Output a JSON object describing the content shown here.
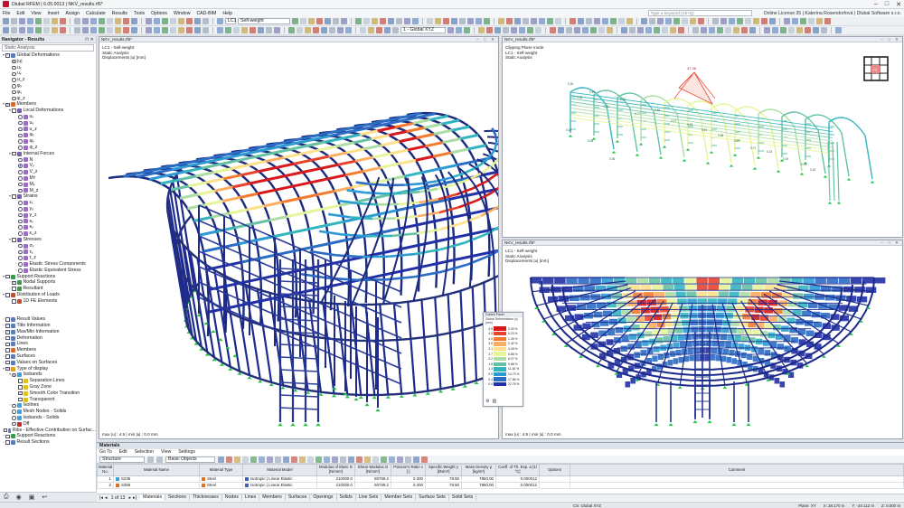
{
  "app": {
    "title": "Dlubal RFEM | 6.05.0013 | NKV_results.rf6*"
  },
  "menu": [
    "File",
    "Edit",
    "View",
    "Insert",
    "Assign",
    "Calculate",
    "Results",
    "Tools",
    "Options",
    "Window",
    "CAD-BIM",
    "Help"
  ],
  "search": {
    "placeholder": "Type a keyword (Alt+Q)"
  },
  "license": "Online License 35 | Katerina Rosendorfová | Dlubal Software s.r.o.",
  "toolbar": {
    "lc_id": "LC1",
    "lc_name": "Self-weight",
    "coord_system": "1 - Global XYZ"
  },
  "navigator": {
    "title": "Navigator - Results",
    "dropdown": "Static Analysis",
    "items": [
      {
        "t": "Global Deformations",
        "lv": 0,
        "c": "chk",
        "on": true,
        "e": "▾",
        "ic": "#5a7fb8"
      },
      {
        "t": "|u|",
        "lv": 1,
        "c": "rad",
        "on": true
      },
      {
        "t": "uₓ",
        "lv": 1,
        "c": "rad"
      },
      {
        "t": "uᵧ",
        "lv": 1,
        "c": "rad"
      },
      {
        "t": "u_z",
        "lv": 1,
        "c": "rad"
      },
      {
        "t": "φₓ",
        "lv": 1,
        "c": "rad"
      },
      {
        "t": "φᵧ",
        "lv": 1,
        "c": "rad"
      },
      {
        "t": "φ_z",
        "lv": 1,
        "c": "rad"
      },
      {
        "t": "Members",
        "lv": 0,
        "c": "chk",
        "on": true,
        "e": "▾",
        "ic": "#d86a2a"
      },
      {
        "t": "Local Deformations",
        "lv": 1,
        "c": "chk",
        "e": "▾",
        "ic": "#7a5fb0"
      },
      {
        "t": "uₓ",
        "lv": 2,
        "c": "rad",
        "ic": "#9a6fc0"
      },
      {
        "t": "uᵧ",
        "lv": 2,
        "c": "rad",
        "ic": "#9a6fc0"
      },
      {
        "t": "u_z",
        "lv": 2,
        "c": "rad",
        "ic": "#9a6fc0"
      },
      {
        "t": "φₓ",
        "lv": 2,
        "c": "rad",
        "ic": "#9a6fc0"
      },
      {
        "t": "φᵧ",
        "lv": 2,
        "c": "rad",
        "ic": "#9a6fc0"
      },
      {
        "t": "φ_z",
        "lv": 2,
        "c": "rad",
        "ic": "#9a6fc0"
      },
      {
        "t": "Internal Forces",
        "lv": 1,
        "c": "chk",
        "e": "▾",
        "ic": "#7a5fb0"
      },
      {
        "t": "N",
        "lv": 2,
        "c": "rad",
        "ic": "#9a6fc0"
      },
      {
        "t": "Vᵧ",
        "lv": 2,
        "c": "rad",
        "on": true,
        "ic": "#9a6fc0"
      },
      {
        "t": "V_z",
        "lv": 2,
        "c": "rad",
        "ic": "#9a6fc0"
      },
      {
        "t": "Mᴛ",
        "lv": 2,
        "c": "rad",
        "ic": "#9a6fc0"
      },
      {
        "t": "Mᵧ",
        "lv": 2,
        "c": "rad",
        "ic": "#9a6fc0"
      },
      {
        "t": "M_z",
        "lv": 2,
        "c": "rad",
        "ic": "#9a6fc0"
      },
      {
        "t": "Strains",
        "lv": 1,
        "c": "chk",
        "e": "▾",
        "ic": "#7a5fb0"
      },
      {
        "t": "εₓ",
        "lv": 2,
        "c": "rad",
        "ic": "#9a6fc0"
      },
      {
        "t": "γᵧ",
        "lv": 2,
        "c": "rad",
        "ic": "#9a6fc0"
      },
      {
        "t": "γ_z",
        "lv": 2,
        "c": "rad",
        "ic": "#9a6fc0"
      },
      {
        "t": "κₓ",
        "lv": 2,
        "c": "rad",
        "ic": "#9a6fc0"
      },
      {
        "t": "κᵧ",
        "lv": 2,
        "c": "rad",
        "ic": "#9a6fc0"
      },
      {
        "t": "κ_z",
        "lv": 2,
        "c": "rad",
        "ic": "#9a6fc0"
      },
      {
        "t": "Stresses",
        "lv": 1,
        "c": "chk",
        "e": "▾",
        "ic": "#7a5fb0"
      },
      {
        "t": "σₓ",
        "lv": 2,
        "c": "rad",
        "ic": "#9a6fc0"
      },
      {
        "t": "τᵧ",
        "lv": 2,
        "c": "rad",
        "ic": "#9a6fc0"
      },
      {
        "t": "τ_z",
        "lv": 2,
        "c": "rad",
        "ic": "#9a6fc0"
      },
      {
        "t": "Elastic Stress Components",
        "lv": 2,
        "c": "rad",
        "e": "›",
        "ic": "#9a6fc0"
      },
      {
        "t": "Elastic Equivalent Stress",
        "lv": 2,
        "c": "rad",
        "e": "›",
        "ic": "#9a6fc0"
      },
      {
        "t": "Support Reactions",
        "lv": 0,
        "c": "chk",
        "e": "▾",
        "ic": "#3a9a4a"
      },
      {
        "t": "Nodal Supports",
        "lv": 1,
        "c": "chk",
        "on": true,
        "e": "›",
        "ic": "#3a9a4a"
      },
      {
        "t": "Resultant",
        "lv": 1,
        "c": "chk",
        "e": "›",
        "ic": "#3a9a4a"
      },
      {
        "t": "Distribution of Loads",
        "lv": 0,
        "c": "chk",
        "e": "▾",
        "ic": "#c05030"
      },
      {
        "t": "1D FE Elements",
        "lv": 1,
        "c": "chk",
        "ic": "#c05030"
      },
      {
        "t": "",
        "lv": 0,
        "c": "none"
      },
      {
        "t": "",
        "lv": 0,
        "c": "none"
      },
      {
        "t": "Result Values",
        "lv": 0,
        "c": "chk",
        "e": "›",
        "ic": "#5a7fb8"
      },
      {
        "t": "Title Information",
        "lv": 0,
        "c": "chk",
        "on": true,
        "e": "›",
        "ic": "#5a7fb8"
      },
      {
        "t": "Max/Min Information",
        "lv": 0,
        "c": "chk",
        "on": true,
        "e": "›",
        "ic": "#5a7fb8"
      },
      {
        "t": "Deformation",
        "lv": 0,
        "c": "chk",
        "e": "›",
        "ic": "#5a7fb8"
      },
      {
        "t": "Lines",
        "lv": 0,
        "c": "chk",
        "e": "›",
        "ic": "#5a7fb8"
      },
      {
        "t": "Members",
        "lv": 0,
        "c": "chk",
        "e": "›",
        "ic": "#d86a2a"
      },
      {
        "t": "Surfaces",
        "lv": 0,
        "c": "chk",
        "e": "›",
        "ic": "#5a7fb8"
      },
      {
        "t": "Values on Surfaces",
        "lv": 0,
        "c": "chk",
        "e": "›",
        "ic": "#5a7fb8"
      },
      {
        "t": "Type of display",
        "lv": 0,
        "c": "chk",
        "on": true,
        "e": "▾",
        "ic": "#e0a020"
      },
      {
        "t": "Isobands",
        "lv": 1,
        "c": "rad",
        "on": true,
        "e": "▾",
        "ic": "#40a0e0"
      },
      {
        "t": "Separation Lines",
        "lv": 2,
        "c": "chk",
        "ic": "#e0c020"
      },
      {
        "t": "Gray Zone",
        "lv": 2,
        "c": "chk",
        "ic": "#e0c020"
      },
      {
        "t": "Smooth Color Transition",
        "lv": 2,
        "c": "chk",
        "on": true,
        "ic": "#e0c020"
      },
      {
        "t": "Transparent",
        "lv": 2,
        "c": "chk",
        "ic": "#e0c020"
      },
      {
        "t": "Isolines",
        "lv": 1,
        "c": "rad",
        "e": "›",
        "ic": "#40a0e0"
      },
      {
        "t": "Mesh Nodes - Solids",
        "lv": 1,
        "c": "rad",
        "ic": "#40a0e0"
      },
      {
        "t": "Isobands - Solids",
        "lv": 1,
        "c": "rad",
        "ic": "#40a0e0"
      },
      {
        "t": "Off",
        "lv": 1,
        "c": "rad",
        "ic": "#c03030"
      },
      {
        "t": "Ribs - Effective Contribution on Surfac...",
        "lv": 0,
        "c": "chk",
        "e": "›",
        "ic": "#5a7fb8"
      },
      {
        "t": "Support Reactions",
        "lv": 0,
        "c": "chk",
        "e": "›",
        "ic": "#3a9a4a"
      },
      {
        "t": "Result Sections",
        "lv": 0,
        "c": "chk",
        "e": "›",
        "ic": "#5a7fb8"
      }
    ]
  },
  "viewports": {
    "main": {
      "tab": "NKV_results.rf6*",
      "lines": [
        "LC1 - Self-weight",
        "Static Analysis",
        "Displacements |u| [mm]"
      ],
      "footer": "max |u| : 4.9 | min |u| : 0.0 mm"
    },
    "top_right": {
      "tab": "NKV_results.rf6*",
      "lines": [
        "Clipping Plane mode",
        "LC1 - Self-weight",
        "Static Analysis"
      ],
      "peak_label": "37.36",
      "labels": [
        "0.26",
        "0.58",
        "0.45",
        "0.31",
        "1.02",
        "0.77",
        "0.49",
        "0.27",
        "0.43",
        "0.51",
        "0.38",
        "0.62",
        "0.71",
        "0.23",
        "0.19",
        "0.11",
        "0.10",
        "0.08",
        "0.36",
        "0.15"
      ],
      "cube": "+X"
    },
    "bottom_right": {
      "tab": "NKV_results.rf6*",
      "lines": [
        "LC1 - Self-weight",
        "Static Analysis",
        "Displacements |u| [mm]"
      ],
      "footer": "max |u| : 4.9 | min |u| : 0.0 mm"
    }
  },
  "control_panel": {
    "title": "Control Panel",
    "subtitle": "Global Deformations |u| [mm]",
    "rows": [
      {
        "v": "4.9",
        "c": "#d7191c",
        "p": "0.00 %"
      },
      {
        "v": "4.5",
        "c": "#e8412c",
        "p": "0.23 %"
      },
      {
        "v": "4.0",
        "c": "#f47a2e",
        "p": "1.26 %"
      },
      {
        "v": "3.6",
        "c": "#fdae61",
        "p": "2.42 %"
      },
      {
        "v": "3.1",
        "c": "#fee08b",
        "p": "4.45 %"
      },
      {
        "v": "2.7",
        "c": "#e6f598",
        "p": "6.86 %"
      },
      {
        "v": "2.2",
        "c": "#abdda4",
        "p": "8.07 %"
      },
      {
        "v": "1.8",
        "c": "#66c2a5",
        "p": "9.88 %"
      },
      {
        "v": "1.3",
        "c": "#33b5c0",
        "p": "11.46 %"
      },
      {
        "v": "0.9",
        "c": "#2c9bd4",
        "p": "14.73 %"
      },
      {
        "v": "0.4",
        "c": "#2b6cc4",
        "p": "17.86 %"
      },
      {
        "v": "0.0",
        "c": "#2231a8",
        "p": "22.78 %"
      }
    ]
  },
  "materials": {
    "title": "Materials",
    "menu": [
      "Go To",
      "Edit",
      "Selection",
      "View",
      "Settings"
    ],
    "filter1": "Structure",
    "filter2": "Basic Objects",
    "headers": [
      "Material No.",
      "Material Name",
      "Material Type",
      "Material Model",
      "Modulus of Elast. E [N/mm²]",
      "Shear Modulus G [N/mm²]",
      "Poisson's Ratio ν [-]",
      "Specific Weight γ [kN/m³]",
      "Mass Density ρ [kg/m³]",
      "Coeff. of Th. Exp. α [1/°C]",
      "Options",
      "Comment"
    ],
    "rows": [
      {
        "no": "1",
        "name": "S235",
        "sw": "#3aa0e0",
        "type": "Steel",
        "model": "Isotropic | Linear Elastic",
        "e": "210000.0",
        "g": "80769.2",
        "nu": "0.300",
        "gamma": "78.50",
        "rho": "7850.00",
        "alpha": "0.000012"
      },
      {
        "no": "2",
        "name": "S355",
        "sw": "#e07020",
        "type": "Steel",
        "model": "Isotropic | Linear Elastic",
        "e": "210000.0",
        "g": "80769.2",
        "nu": "0.300",
        "gamma": "78.50",
        "rho": "7850.00",
        "alpha": "0.000012"
      }
    ],
    "pager": "1 of 13",
    "tabs": [
      "Materials",
      "Sections",
      "Thicknesses",
      "Nodes",
      "Lines",
      "Members",
      "Surfaces",
      "Openings",
      "Solids",
      "Line Sets",
      "Member Sets",
      "Surface Sets",
      "Solid Sets"
    ]
  },
  "status": {
    "cs": "CS: Global XYZ",
    "plane": "Plane: XY",
    "x": "X: 28.170 m",
    "y": "Y: -34.112 m",
    "z": "Z: 0.000 m"
  }
}
